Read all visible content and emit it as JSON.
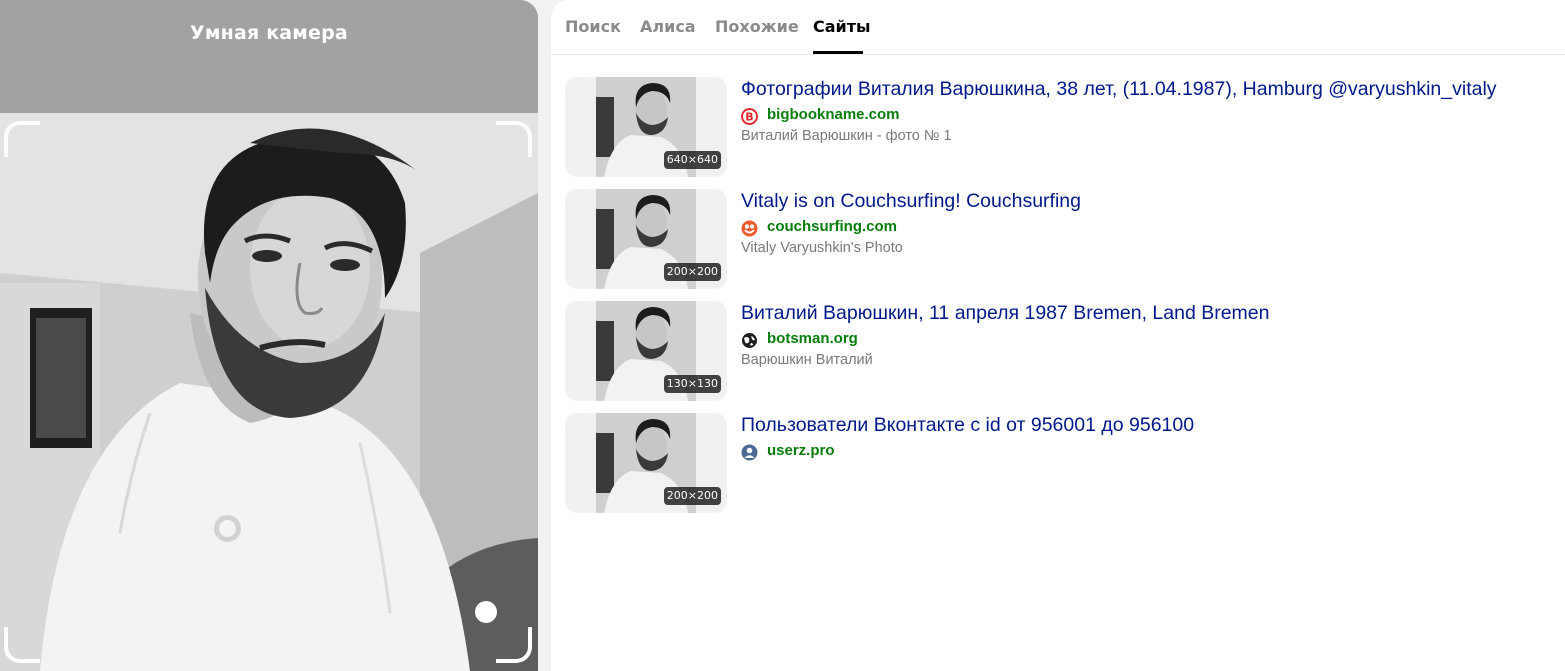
{
  "camera": {
    "title": "Умная камера"
  },
  "tabs": [
    {
      "label": "Поиск",
      "active": false
    },
    {
      "label": "Алиса",
      "active": false
    },
    {
      "label": "Похожие",
      "active": false
    },
    {
      "label": "Сайты",
      "active": true
    }
  ],
  "results": [
    {
      "title": "Фотографии Виталия Варюшкина, 38 лет, (11.04.1987), Hamburg @varyushkin_vitaly",
      "domain": "bigbookname.com",
      "snippet": "Виталий Варюшкин - фото № 1",
      "size": "640×640",
      "favicon": "bigbookname-b-icon"
    },
    {
      "title": "Vitaly is on Couchsurfing! Couchsurfing",
      "domain": "couchsurfing.com",
      "snippet": "Vitaly Varyushkin's Photo",
      "size": "200×200",
      "favicon": "couchsurfing-icon"
    },
    {
      "title": "Виталий Варюшкин, 11 апреля 1987 Bremen, Land Bremen",
      "domain": "botsman.org",
      "snippet": "Варюшкин Виталий",
      "size": "130×130",
      "favicon": "globe-icon"
    },
    {
      "title": "Пользователи Вконтакте с id от 956001 до 956100",
      "domain": "userz.pro",
      "snippet": "",
      "size": "200×200",
      "favicon": "user-icon"
    }
  ],
  "colors": {
    "link": "#001a8c",
    "domain": "#077d0a",
    "snippet": "#7a7a7a"
  }
}
